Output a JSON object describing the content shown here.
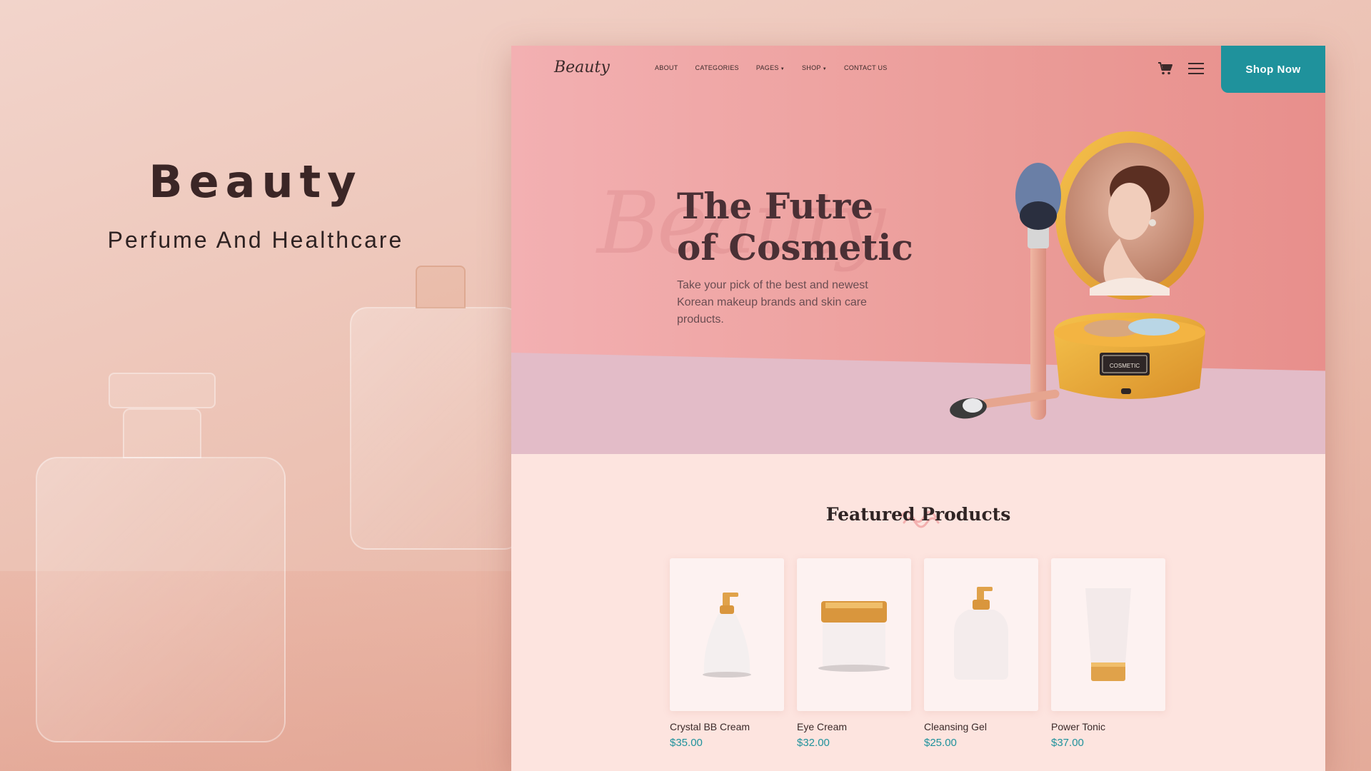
{
  "promo": {
    "title": "Beauty",
    "subtitle": "Perfume And Healthcare"
  },
  "site": {
    "logo": "Beauty",
    "nav": [
      {
        "label": "ABOUT",
        "has_dropdown": false
      },
      {
        "label": "CATEGORIES",
        "has_dropdown": false
      },
      {
        "label": "PAGES",
        "has_dropdown": true
      },
      {
        "label": "SHOP",
        "has_dropdown": true
      },
      {
        "label": "CONTACT US",
        "has_dropdown": false
      }
    ],
    "icons": [
      "cart-icon",
      "menu-icon"
    ],
    "cta_label": "Shop Now"
  },
  "hero": {
    "watermark": "Beauty",
    "title_line1": "The Futre",
    "title_line2": "of Cosmetic",
    "description": "Take your pick of the best and newest Korean makeup brands and skin care products.",
    "jar_label": "COSMETIC"
  },
  "featured": {
    "title": "Featured Products",
    "products": [
      {
        "name": "Crystal BB Cream",
        "price": "$35.00",
        "image": "pump-bottle"
      },
      {
        "name": "Eye Cream",
        "price": "$32.00",
        "image": "cream-jar"
      },
      {
        "name": "Cleansing Gel",
        "price": "$25.00",
        "image": "pump-bottle-tall"
      },
      {
        "name": "Power Tonic",
        "price": "$37.00",
        "image": "tube"
      }
    ]
  },
  "colors": {
    "accent": "#1f929c",
    "hero_pink": "#eb9c98",
    "band_lilac": "#e3bcc8",
    "page_bg": "#fde4df",
    "gold": "#e9aa3a"
  }
}
